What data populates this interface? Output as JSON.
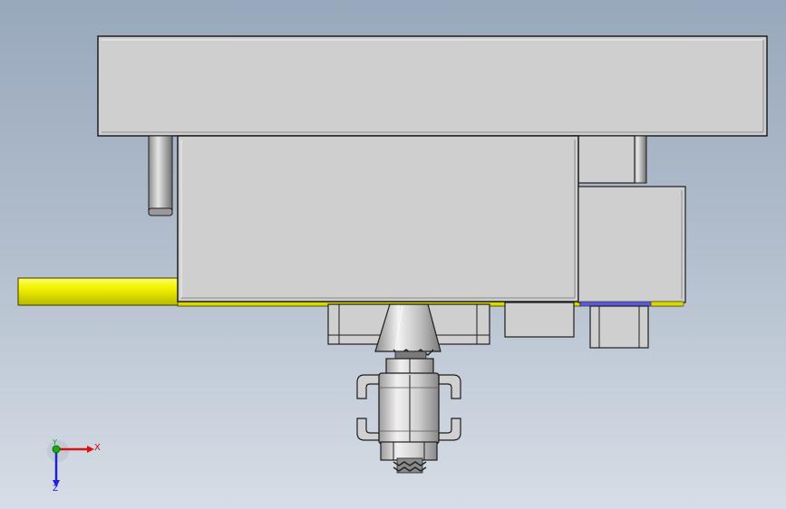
{
  "viewport": {
    "background_top": "#98a8bc",
    "background_bottom": "#d6dde6"
  },
  "model": {
    "part_color": "#cfcfcf",
    "edge_color": "#1e1e1e",
    "rod_color": "#f0f000",
    "accent_blue": "#2b2bd0"
  },
  "triad": {
    "x_label": "X",
    "y_label": "Y",
    "z_label": "Z",
    "x_color": "#e01010",
    "y_color": "#10b010",
    "z_color": "#2020d8"
  }
}
